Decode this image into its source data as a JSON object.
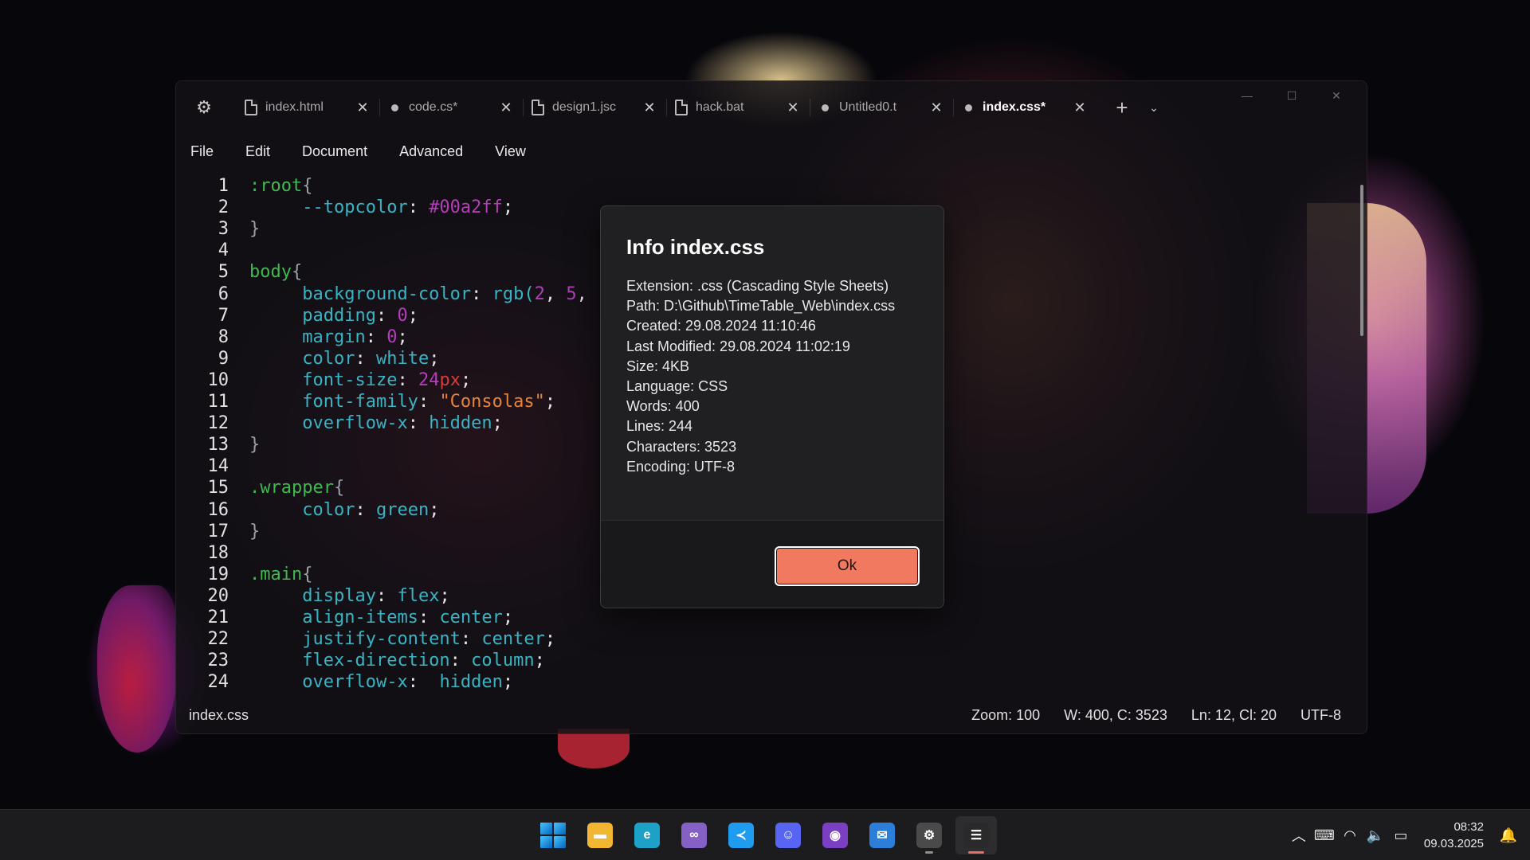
{
  "tabs": [
    {
      "label": "index.html",
      "icon": "file",
      "modified": false,
      "active": false
    },
    {
      "label": "code.cs*",
      "icon": "dot",
      "modified": true,
      "active": false
    },
    {
      "label": "design1.jsc",
      "icon": "file",
      "modified": false,
      "active": false
    },
    {
      "label": "hack.bat",
      "icon": "file",
      "modified": false,
      "active": false
    },
    {
      "label": "Untitled0.t",
      "icon": "dot",
      "modified": true,
      "active": false
    },
    {
      "label": "index.css*",
      "icon": "dot",
      "modified": true,
      "active": true
    }
  ],
  "menu": [
    "File",
    "Edit",
    "Document",
    "Advanced",
    "View"
  ],
  "code_lines": [
    {
      "n": "1",
      "tokens": [
        [
          "sel",
          ":root"
        ],
        [
          "brace",
          "{"
        ]
      ]
    },
    {
      "n": "2",
      "tokens": [
        [
          "punc",
          "     "
        ],
        [
          "prop",
          "--topcolor"
        ],
        [
          "punc",
          ": "
        ],
        [
          "hex",
          "#00a2ff"
        ],
        [
          "punc",
          ";"
        ]
      ]
    },
    {
      "n": "3",
      "tokens": [
        [
          "brace",
          "}"
        ]
      ]
    },
    {
      "n": "4",
      "tokens": []
    },
    {
      "n": "5",
      "tokens": [
        [
          "sel",
          "body"
        ],
        [
          "brace",
          "{"
        ]
      ]
    },
    {
      "n": "6",
      "tokens": [
        [
          "punc",
          "     "
        ],
        [
          "prop",
          "background-color"
        ],
        [
          "punc",
          ": "
        ],
        [
          "val",
          "rgb("
        ],
        [
          "num",
          "2"
        ],
        [
          "punc",
          ", "
        ],
        [
          "num",
          "5"
        ],
        [
          "punc",
          ","
        ]
      ]
    },
    {
      "n": "7",
      "tokens": [
        [
          "punc",
          "     "
        ],
        [
          "prop",
          "padding"
        ],
        [
          "punc",
          ": "
        ],
        [
          "num",
          "0"
        ],
        [
          "punc",
          ";"
        ]
      ]
    },
    {
      "n": "8",
      "tokens": [
        [
          "punc",
          "     "
        ],
        [
          "prop",
          "margin"
        ],
        [
          "punc",
          ": "
        ],
        [
          "num",
          "0"
        ],
        [
          "punc",
          ";"
        ]
      ]
    },
    {
      "n": "9",
      "tokens": [
        [
          "punc",
          "     "
        ],
        [
          "prop",
          "color"
        ],
        [
          "punc",
          ": "
        ],
        [
          "val",
          "white"
        ],
        [
          "punc",
          ";"
        ]
      ]
    },
    {
      "n": "10",
      "tokens": [
        [
          "punc",
          "     "
        ],
        [
          "prop",
          "font-size"
        ],
        [
          "punc",
          ": "
        ],
        [
          "num",
          "24"
        ],
        [
          "unit",
          "px"
        ],
        [
          "punc",
          ";"
        ]
      ]
    },
    {
      "n": "11",
      "tokens": [
        [
          "punc",
          "     "
        ],
        [
          "prop",
          "font-family"
        ],
        [
          "punc",
          ": "
        ],
        [
          "str",
          "\"Consolas\""
        ],
        [
          "punc",
          ";"
        ]
      ]
    },
    {
      "n": "12",
      "tokens": [
        [
          "punc",
          "     "
        ],
        [
          "prop",
          "overflow-x"
        ],
        [
          "punc",
          ": "
        ],
        [
          "val",
          "hidden"
        ],
        [
          "punc",
          ";"
        ]
      ]
    },
    {
      "n": "13",
      "tokens": [
        [
          "brace",
          "}"
        ]
      ]
    },
    {
      "n": "14",
      "tokens": []
    },
    {
      "n": "15",
      "tokens": [
        [
          "sel",
          ".wrapper"
        ],
        [
          "brace",
          "{"
        ]
      ]
    },
    {
      "n": "16",
      "tokens": [
        [
          "punc",
          "     "
        ],
        [
          "prop",
          "color"
        ],
        [
          "punc",
          ": "
        ],
        [
          "val",
          "green"
        ],
        [
          "punc",
          ";"
        ]
      ]
    },
    {
      "n": "17",
      "tokens": [
        [
          "brace",
          "}"
        ]
      ]
    },
    {
      "n": "18",
      "tokens": []
    },
    {
      "n": "19",
      "tokens": [
        [
          "sel",
          ".main"
        ],
        [
          "brace",
          "{"
        ]
      ]
    },
    {
      "n": "20",
      "tokens": [
        [
          "punc",
          "     "
        ],
        [
          "prop",
          "display"
        ],
        [
          "punc",
          ": "
        ],
        [
          "val",
          "flex"
        ],
        [
          "punc",
          ";"
        ]
      ]
    },
    {
      "n": "21",
      "tokens": [
        [
          "punc",
          "     "
        ],
        [
          "prop",
          "align-items"
        ],
        [
          "punc",
          ": "
        ],
        [
          "val",
          "center"
        ],
        [
          "punc",
          ";"
        ]
      ]
    },
    {
      "n": "22",
      "tokens": [
        [
          "punc",
          "     "
        ],
        [
          "prop",
          "justify-content"
        ],
        [
          "punc",
          ": "
        ],
        [
          "val",
          "center"
        ],
        [
          "punc",
          ";"
        ]
      ]
    },
    {
      "n": "23",
      "tokens": [
        [
          "punc",
          "     "
        ],
        [
          "prop",
          "flex-direction"
        ],
        [
          "punc",
          ": "
        ],
        [
          "val",
          "column"
        ],
        [
          "punc",
          ";"
        ]
      ]
    },
    {
      "n": "24",
      "tokens": [
        [
          "punc",
          "     "
        ],
        [
          "prop",
          "overflow-x"
        ],
        [
          "punc",
          ":  "
        ],
        [
          "val",
          "hidden"
        ],
        [
          "punc",
          ";"
        ]
      ]
    }
  ],
  "status": {
    "file": "index.css",
    "zoom": "Zoom: 100",
    "words_chars": "W: 400, C: 3523",
    "position": "Ln: 12, Cl: 20",
    "encoding": "UTF-8"
  },
  "dialog": {
    "title": "Info index.css",
    "lines": [
      "Extension: .css (Cascading Style Sheets)",
      "Path: D:\\Github\\TimeTable_Web\\index.css",
      "Created: 29.08.2024 11:10:46",
      "Last Modified: 29.08.2024 11:02:19",
      "Size: 4KB",
      "Language: CSS",
      "Words: 400",
      "Lines: 244",
      "Characters: 3523",
      "Encoding: UTF-8"
    ],
    "ok_label": "Ok"
  },
  "taskbar": {
    "apps": [
      {
        "name": "start",
        "glyph": "",
        "color": "#0a84d6",
        "active": false,
        "running": false
      },
      {
        "name": "file-explorer",
        "glyph": "▬",
        "color": "#f2b632",
        "active": false,
        "running": false
      },
      {
        "name": "edge",
        "glyph": "e",
        "color": "#1da1c6",
        "active": false,
        "running": false
      },
      {
        "name": "visual-studio",
        "glyph": "∞",
        "color": "#8661c5",
        "active": false,
        "running": false
      },
      {
        "name": "vscode",
        "glyph": "≺",
        "color": "#1f9cf0",
        "active": false,
        "running": false
      },
      {
        "name": "discord",
        "glyph": "☺",
        "color": "#5865f2",
        "active": false,
        "running": false
      },
      {
        "name": "github-desktop",
        "glyph": "◉",
        "color": "#7b3fc4",
        "active": false,
        "running": false
      },
      {
        "name": "thunderbird",
        "glyph": "✉",
        "color": "#2b7fd9",
        "active": false,
        "running": false
      },
      {
        "name": "settings",
        "glyph": "⚙",
        "color": "#4a4a4a",
        "active": false,
        "running": true
      },
      {
        "name": "text-editor",
        "glyph": "☰",
        "color": "#2a2a2a",
        "active": true,
        "running": true
      }
    ],
    "time": "08:32",
    "date": "09.03.2025"
  },
  "colors": {
    "accent_ok": "#f0795f",
    "selector": "#3fb950",
    "property": "#39b4c4",
    "number": "#b43db9",
    "string": "#e6843a"
  }
}
